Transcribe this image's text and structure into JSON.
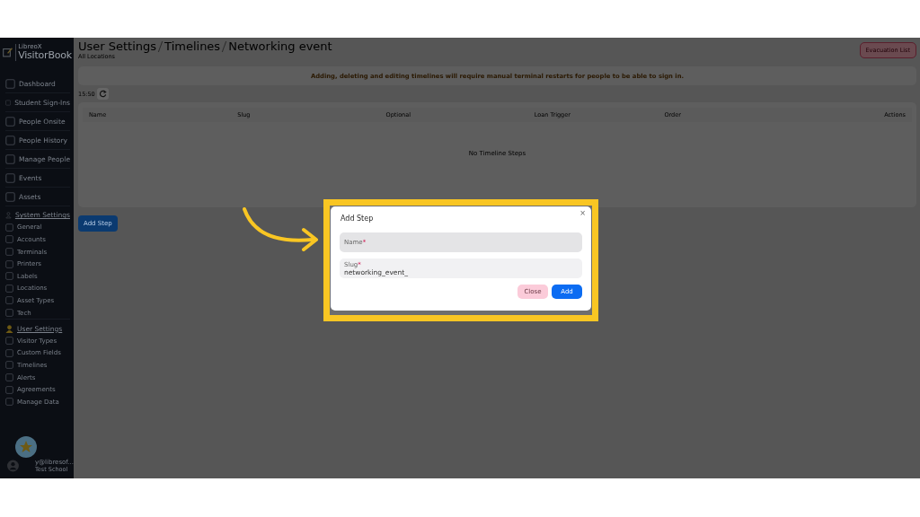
{
  "sidebar": {
    "logo": {
      "small": "LibreoX",
      "name": "VisitorBook"
    },
    "items": [
      {
        "label": "Dashboard",
        "kind": "link"
      },
      {
        "label": "Student Sign-Ins",
        "kind": "link"
      },
      {
        "label": "People Onsite",
        "kind": "link"
      },
      {
        "label": "People History",
        "kind": "link"
      },
      {
        "label": "Manage People",
        "kind": "link"
      },
      {
        "label": "Events",
        "kind": "link"
      },
      {
        "label": "Assets",
        "kind": "link"
      },
      {
        "label": "System Settings",
        "kind": "section",
        "active": false
      },
      {
        "label": "General",
        "kind": "sub"
      },
      {
        "label": "Accounts",
        "kind": "sub"
      },
      {
        "label": "Terminals",
        "kind": "sub"
      },
      {
        "label": "Printers",
        "kind": "sub"
      },
      {
        "label": "Labels",
        "kind": "sub"
      },
      {
        "label": "Locations",
        "kind": "sub"
      },
      {
        "label": "Asset Types",
        "kind": "sub"
      },
      {
        "label": "Tech",
        "kind": "sub"
      },
      {
        "label": "User Settings",
        "kind": "section",
        "active": true
      },
      {
        "label": "Visitor Types",
        "kind": "sub"
      },
      {
        "label": "Custom Fields",
        "kind": "sub"
      },
      {
        "label": "Timelines",
        "kind": "sub"
      },
      {
        "label": "Alerts",
        "kind": "sub"
      },
      {
        "label": "Agreements",
        "kind": "sub"
      },
      {
        "label": "Manage Data",
        "kind": "sub"
      }
    ],
    "user": {
      "email": "y@libresof...",
      "school": "Test School"
    }
  },
  "header": {
    "breadcrumb": [
      "User Settings",
      "Timelines",
      "Networking event"
    ],
    "subtitle": "All Locations",
    "evacuation_button": "Evacuation List"
  },
  "alert": "Adding, deleting and editing timelines will require manual terminal restarts for people to be able to sign in.",
  "time": "15:50",
  "table": {
    "columns": [
      "Name",
      "Slug",
      "Optional",
      "Loan Trigger",
      "Order",
      "Actions"
    ],
    "empty": "No Timeline Steps"
  },
  "add_button": "Add Step",
  "modal": {
    "title": "Add Step",
    "close": "×",
    "fields": [
      {
        "label": "Name",
        "mark": "*",
        "focused": true
      },
      {
        "label": "Slug",
        "mark": "*",
        "focused": false,
        "value": "networking_event_"
      }
    ],
    "buttons": [
      {
        "label": "Close",
        "kind": "secondary"
      },
      {
        "label": "Add",
        "kind": "primary"
      }
    ]
  }
}
